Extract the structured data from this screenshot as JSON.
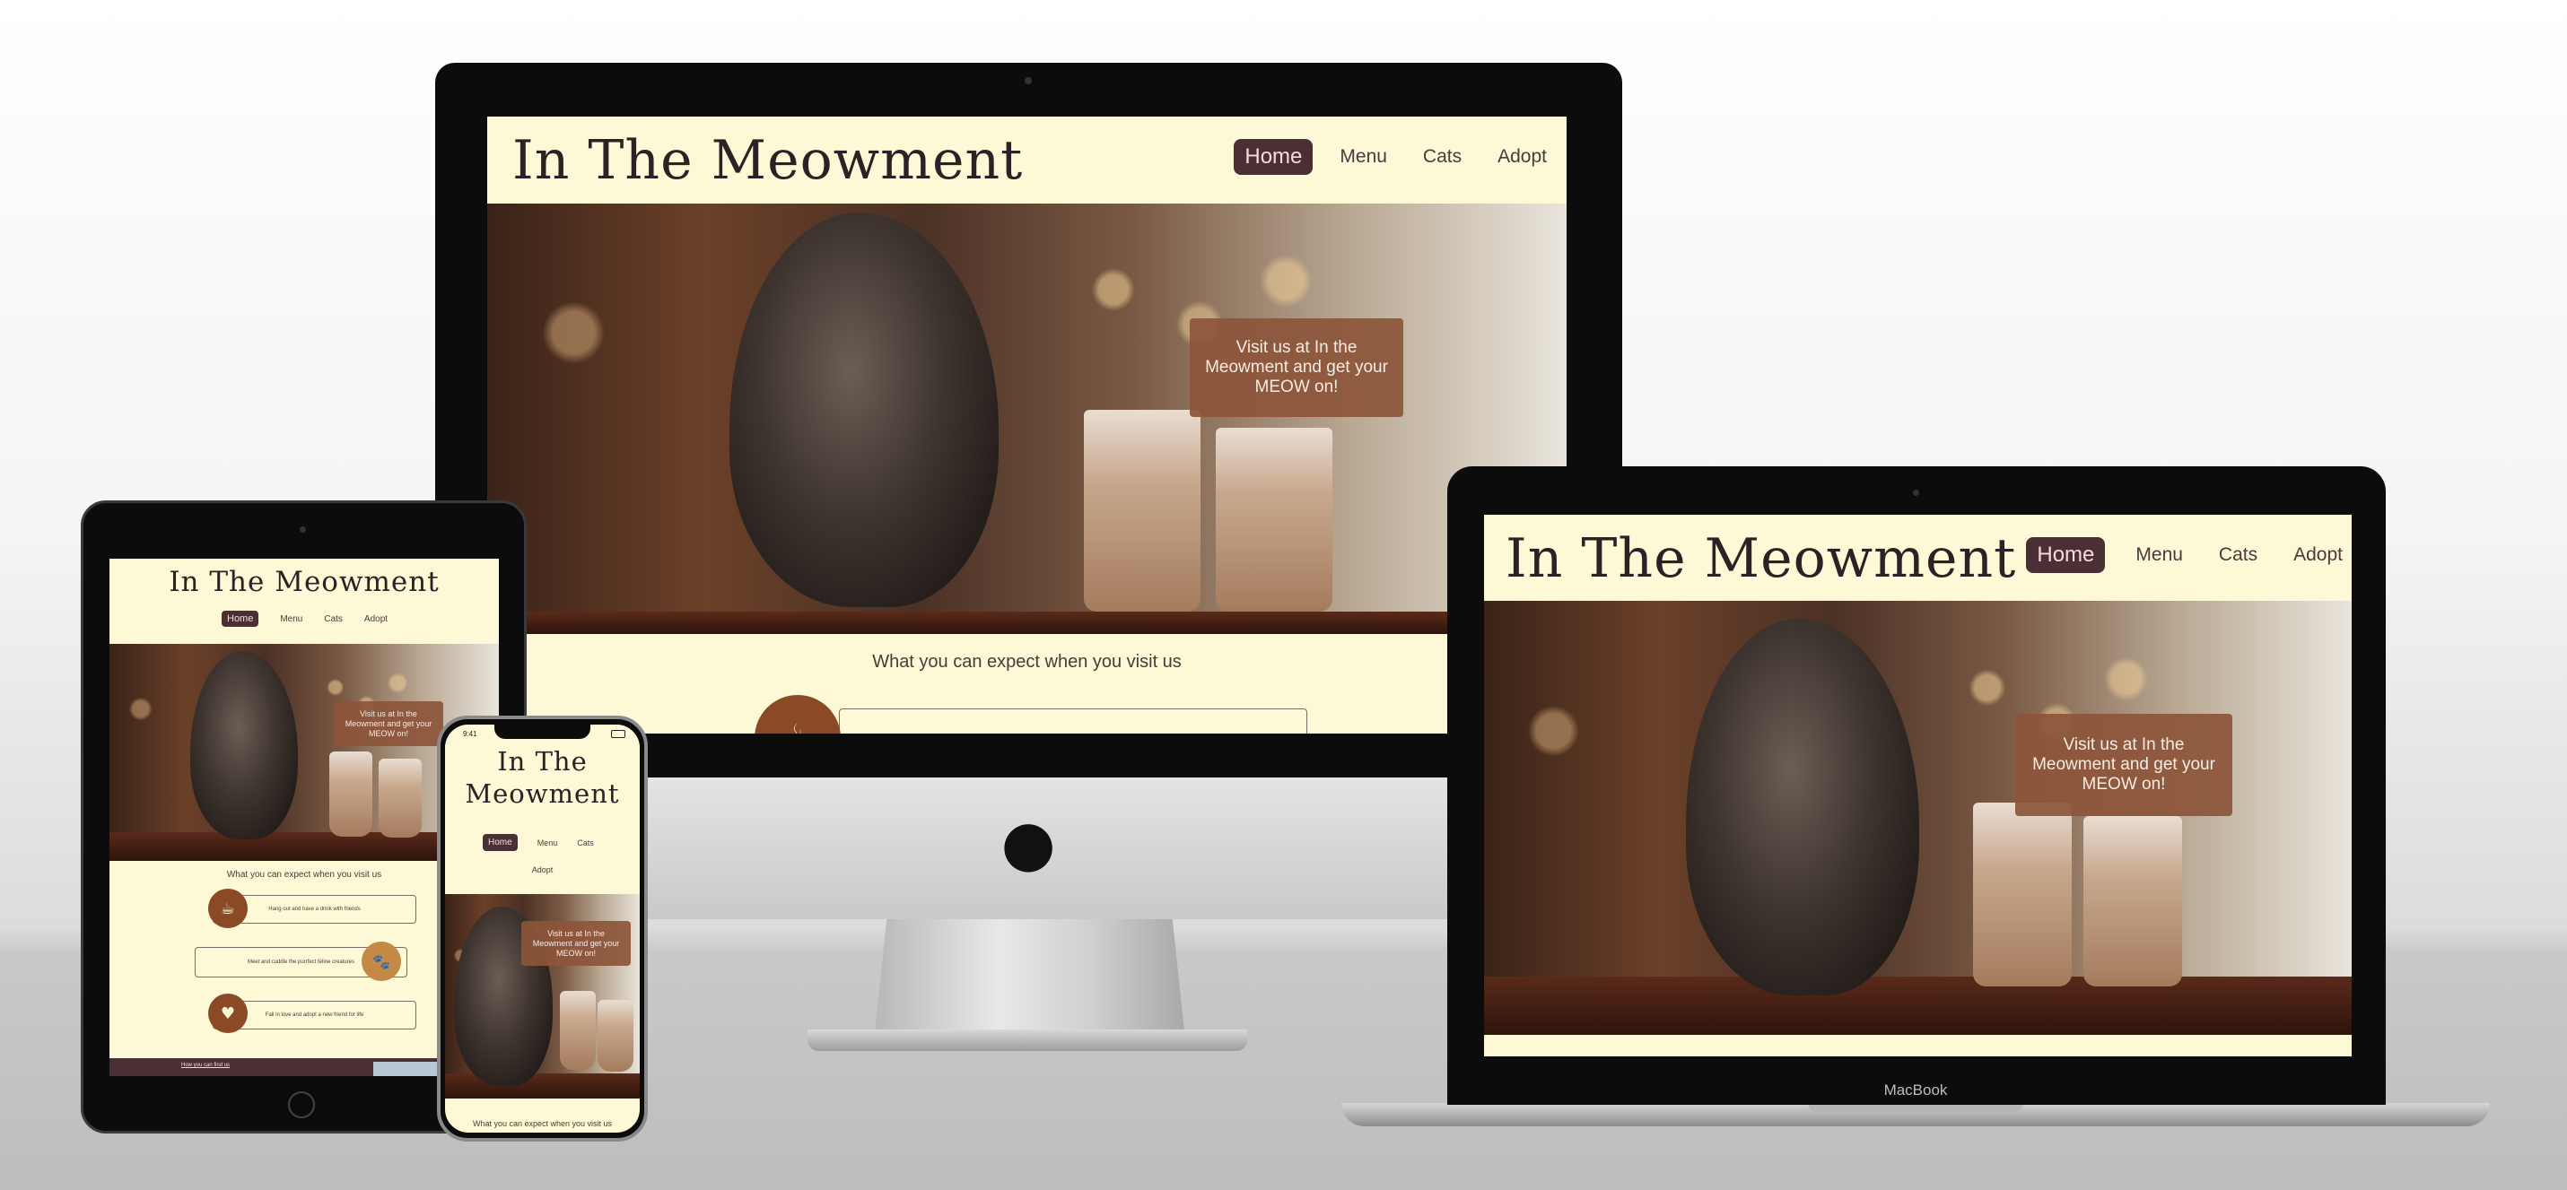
{
  "site": {
    "logo": "In The Meowment",
    "logo_line1": "In The",
    "logo_line2": "Meowment",
    "nav": [
      "Home",
      "Menu",
      "Cats",
      "Adopt"
    ],
    "hero_text": "Visit us at In the Meowment and get your MEOW on!",
    "expect": "What you can expect when you visit us",
    "features": [
      {
        "icon": "coffee-icon",
        "glyph": "☕",
        "text": "Hang out and have a drink with friends"
      },
      {
        "icon": "paw-icon",
        "glyph": "🐾",
        "text": "Meet and cuddle the purrfect feline creatures"
      },
      {
        "icon": "heart-icon",
        "glyph": "♥",
        "text": "Fall in love and adopt a new friend for life"
      }
    ],
    "footer_link": "How you can find us"
  },
  "devices": {
    "laptop_label": "MacBook",
    "phone_time": "9:41"
  },
  "colors": {
    "header_bg": "#fdf8d6",
    "nav_active": "#4a3035",
    "callout": "#8c553a",
    "icon_circle": "#8a4a25"
  }
}
